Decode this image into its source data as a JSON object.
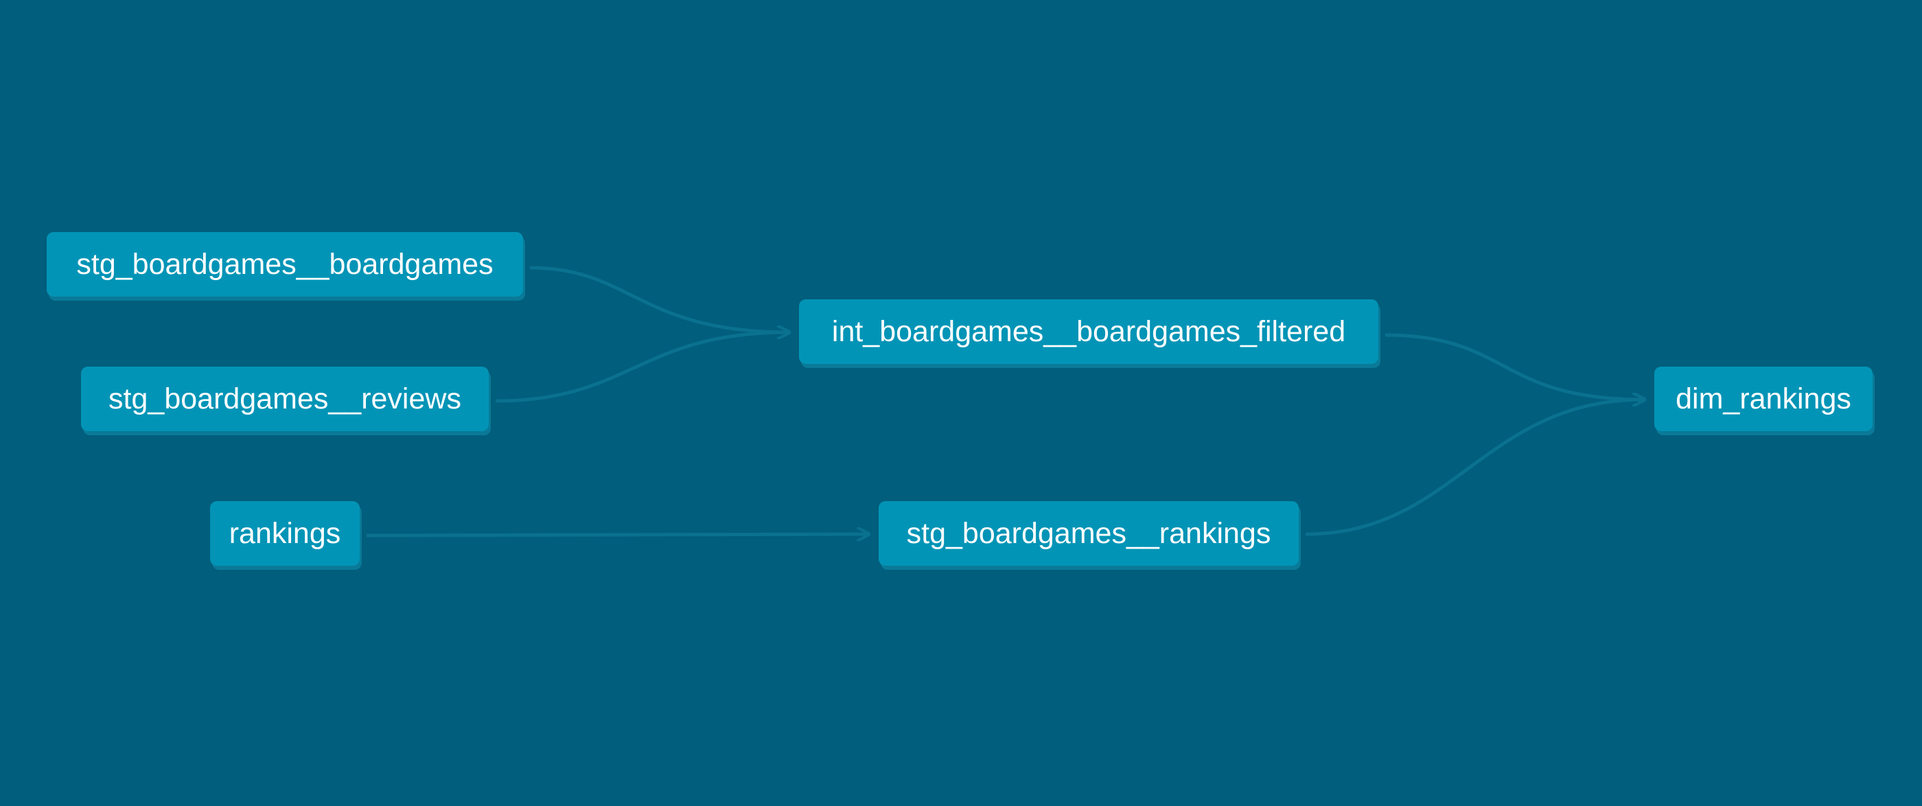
{
  "nodes": {
    "stg_boardgames": {
      "label": "stg_boardgames__boardgames"
    },
    "stg_reviews": {
      "label": "stg_boardgames__reviews"
    },
    "rankings": {
      "label": "rankings"
    },
    "int_filtered": {
      "label": "int_boardgames__boardgames_filtered"
    },
    "stg_rankings": {
      "label": "stg_boardgames__rankings"
    },
    "dim_rankings": {
      "label": "dim_rankings"
    }
  },
  "edges": [
    {
      "from": "stg_boardgames__boardgames",
      "to": "int_boardgames__boardgames_filtered"
    },
    {
      "from": "stg_boardgames__reviews",
      "to": "int_boardgames__boardgames_filtered"
    },
    {
      "from": "rankings",
      "to": "stg_boardgames__rankings"
    },
    {
      "from": "int_boardgames__boardgames_filtered",
      "to": "dim_rankings"
    },
    {
      "from": "stg_boardgames__rankings",
      "to": "dim_rankings"
    }
  ],
  "colors": {
    "background": "#015e7c",
    "node_fill": "#0294b6",
    "node_shadow": "#0a7a98",
    "edge": "#0a718f",
    "node_text": "#ffffff"
  }
}
